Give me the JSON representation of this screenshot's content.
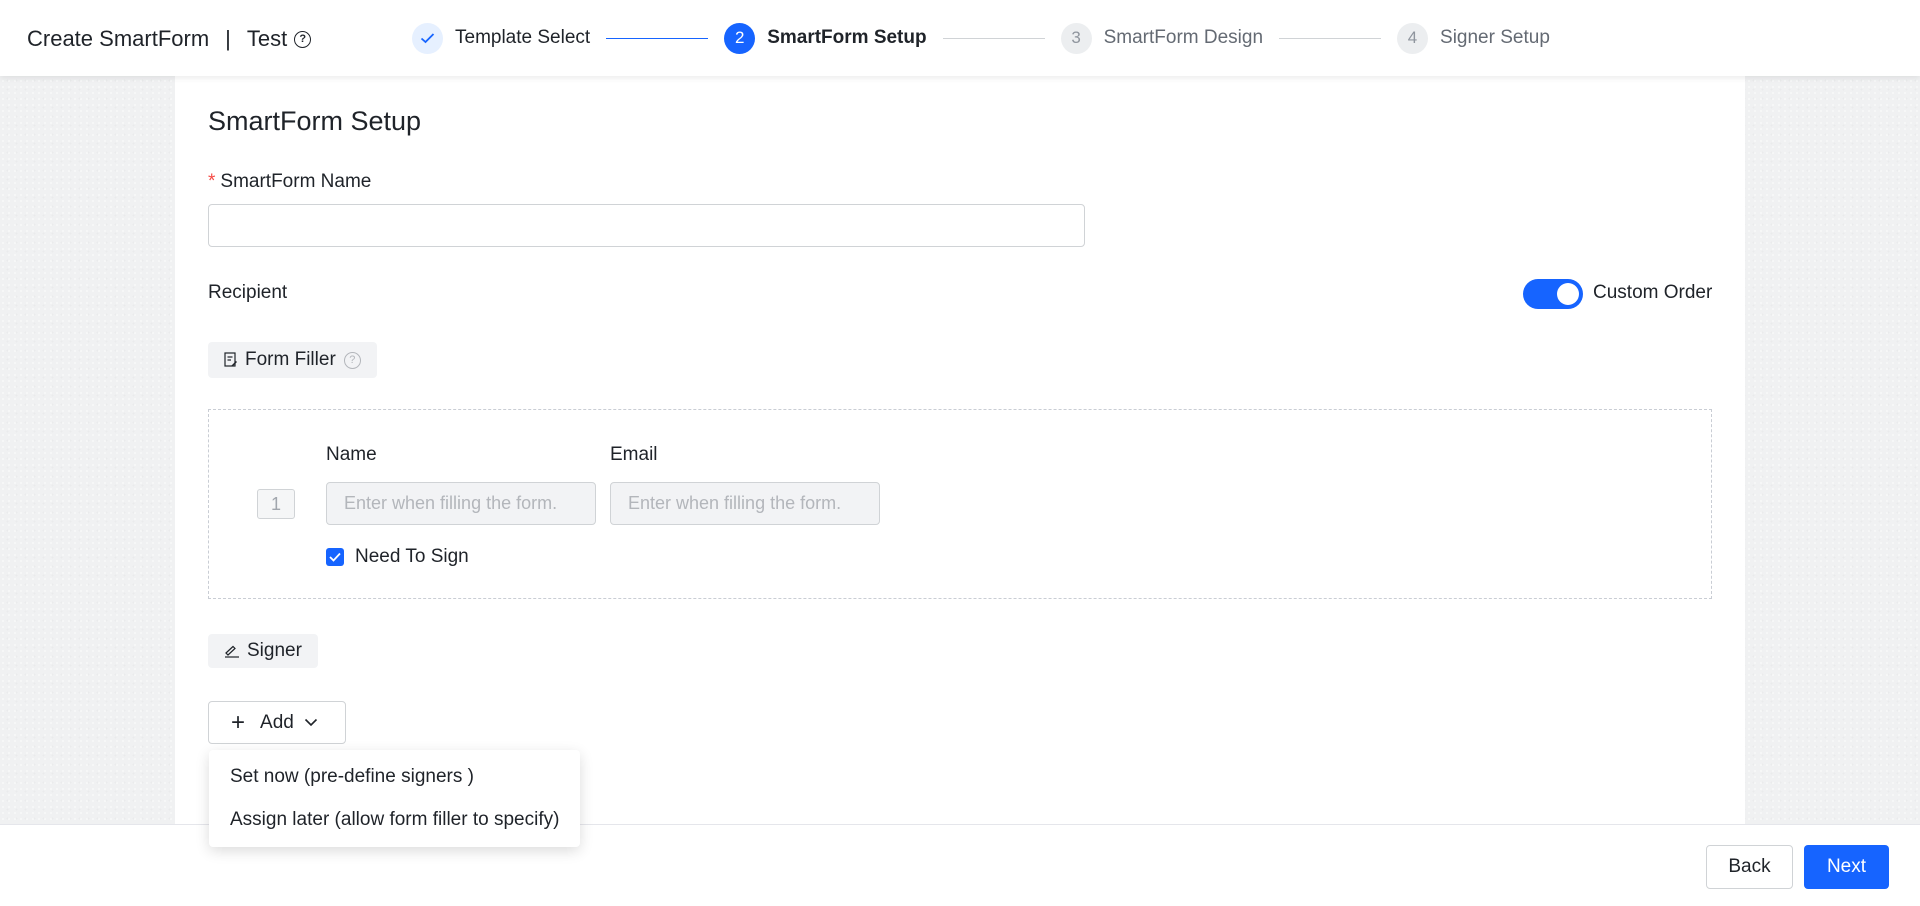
{
  "header": {
    "title": "Create SmartForm",
    "separator": "|",
    "template_name": "Test",
    "help_glyph": "?"
  },
  "steps": [
    {
      "number": "",
      "label": "Template Select",
      "state": "done"
    },
    {
      "number": "2",
      "label": "SmartForm Setup",
      "state": "active"
    },
    {
      "number": "3",
      "label": "SmartForm Design",
      "state": "todo"
    },
    {
      "number": "4",
      "label": "Signer Setup",
      "state": "todo"
    }
  ],
  "form": {
    "section_title": "SmartForm Setup",
    "name_required_mark": "*",
    "name_label": "SmartForm Name",
    "name_value": "",
    "recipient_label": "Recipient",
    "custom_order_label": "Custom Order",
    "custom_order_on": true,
    "form_filler_label": "Form Filler",
    "form_filler_help": "?",
    "filler": {
      "order": "1",
      "name_label": "Name",
      "email_label": "Email",
      "name_placeholder": "Enter when filling the form.",
      "email_placeholder": "Enter when filling the form.",
      "need_to_sign_label": "Need To Sign",
      "need_to_sign_checked": true
    },
    "signer_label": "Signer",
    "add_label": "Add"
  },
  "add_menu": {
    "items": [
      "Set now (pre-define signers )",
      "Assign later (allow form filler to specify)"
    ]
  },
  "footer": {
    "back_label": "Back",
    "next_label": "Next"
  },
  "colors": {
    "primary": "#1664ff",
    "required": "#f54a45",
    "chip_bg": "#f2f3f5"
  },
  "icons": [
    "help-circle-icon",
    "check-icon",
    "form-filler-icon",
    "signer-icon",
    "plus-icon",
    "chevron-down-icon"
  ]
}
